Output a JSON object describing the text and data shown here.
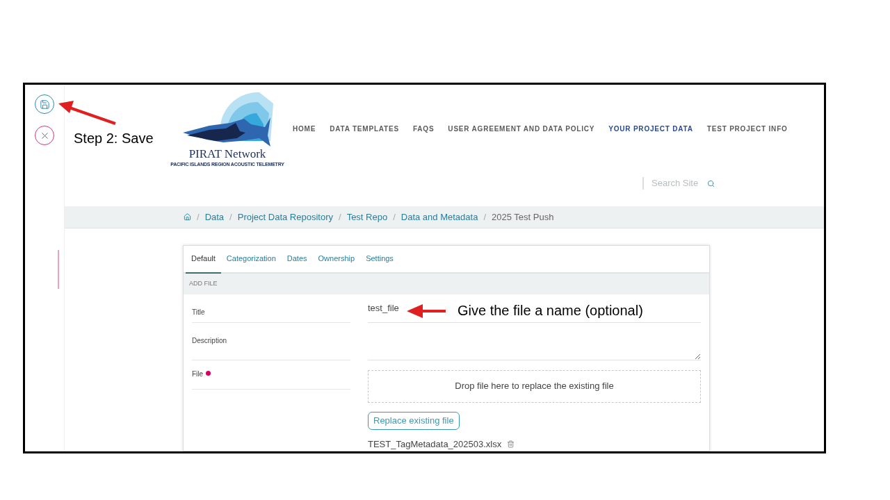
{
  "annotations": [
    {
      "kind": "step",
      "text": "Step 2: Save"
    },
    {
      "kind": "hint",
      "text": "Give the file a name (optional)"
    }
  ],
  "logo": {
    "name": "PIRAT Network",
    "tagline": "PACIFIC ISLANDS REGION ACOUSTIC TELEMETRY"
  },
  "nav": [
    {
      "label": "HOME",
      "selected": false
    },
    {
      "label": "DATA TEMPLATES",
      "selected": false
    },
    {
      "label": "FAQS",
      "selected": false
    },
    {
      "label": "USER AGREEMENT AND DATA POLICY",
      "selected": false
    },
    {
      "label": "YOUR PROJECT DATA",
      "selected": true
    },
    {
      "label": "TEST PROJECT INFO",
      "selected": false
    }
  ],
  "search": {
    "placeholder": "Search Site"
  },
  "breadcrumb": {
    "separator": "/",
    "links": [
      "Data",
      "Project Data Repository",
      "Test Repo",
      "Data and Metadata"
    ],
    "current": "2025 Test Push"
  },
  "tabs": [
    {
      "label": "Default",
      "selected": true
    },
    {
      "label": "Categorization",
      "selected": false
    },
    {
      "label": "Dates",
      "selected": false
    },
    {
      "label": "Ownership",
      "selected": false
    },
    {
      "label": "Settings",
      "selected": false
    }
  ],
  "section": "ADD FILE",
  "form": {
    "title": {
      "label": "Title",
      "value": "test_file"
    },
    "description": {
      "label": "Description"
    },
    "file": {
      "label": "File",
      "required": true,
      "dropzone": "Drop file here to replace the existing file",
      "button": "Replace existing file",
      "filename": "TEST_TagMetadata_202503.xlsx"
    }
  }
}
